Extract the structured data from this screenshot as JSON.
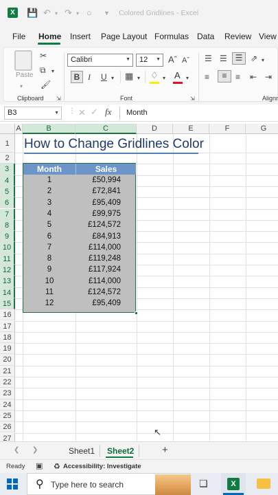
{
  "window": {
    "title": "Colored Gridlines  -  Excel",
    "app_icon_letter": "X"
  },
  "menu": {
    "tabs": [
      "File",
      "Home",
      "Insert",
      "Page Layout",
      "Formulas",
      "Data",
      "Review",
      "View"
    ],
    "active": "Home"
  },
  "ribbon": {
    "clipboard": {
      "label": "Clipboard",
      "paste_label": "Paste"
    },
    "font": {
      "label": "Font",
      "font_name": "Calibri",
      "font_size": "12"
    },
    "alignment": {
      "label": "Alignm"
    }
  },
  "formula_bar": {
    "name_box": "B3",
    "fx_label": "fx",
    "content": "Month"
  },
  "grid": {
    "columns": [
      "A",
      "B",
      "C",
      "D",
      "E",
      "F",
      "G"
    ],
    "selected_columns": [
      "B",
      "C"
    ],
    "rows": [
      "1",
      "2",
      "3",
      "4",
      "5",
      "6",
      "7",
      "8",
      "9",
      "10",
      "11",
      "12",
      "13",
      "14",
      "15",
      "16",
      "17",
      "18",
      "19",
      "20",
      "21",
      "22",
      "23",
      "24",
      "25",
      "26",
      "27"
    ],
    "selected_rows_from": 3,
    "selected_rows_to": 15,
    "sheet_title": "How to Change Gridlines Color",
    "table": {
      "headers": [
        "Month",
        "Sales"
      ],
      "rows": [
        [
          "1",
          "£50,994"
        ],
        [
          "2",
          "£72,841"
        ],
        [
          "3",
          "£95,409"
        ],
        [
          "4",
          "£99,975"
        ],
        [
          "5",
          "£124,572"
        ],
        [
          "6",
          "£84,913"
        ],
        [
          "7",
          "£114,000"
        ],
        [
          "8",
          "£119,248"
        ],
        [
          "9",
          "£117,924"
        ],
        [
          "10",
          "£114,000"
        ],
        [
          "11",
          "£124,572"
        ],
        [
          "12",
          "£95,409"
        ]
      ]
    }
  },
  "sheets": {
    "tabs": [
      "Sheet1",
      "Sheet2"
    ],
    "active": "Sheet2",
    "add_label": "+"
  },
  "status": {
    "ready": "Ready",
    "accessibility": "Accessibility: Investigate"
  },
  "taskbar": {
    "search_placeholder": "Type here to search"
  },
  "colors": {
    "excel_green": "#107c41",
    "table_header": "#6e95c9",
    "table_fill": "#bfbfbf",
    "title_color": "#1f3b6d"
  }
}
